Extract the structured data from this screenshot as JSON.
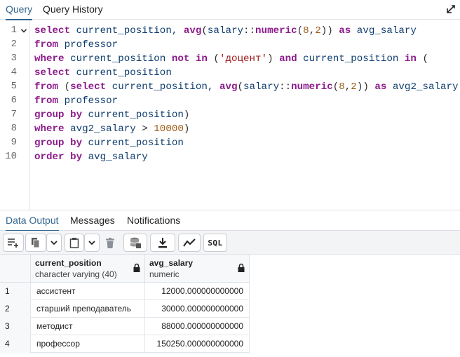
{
  "top_tabs": {
    "query": "Query",
    "history": "Query History"
  },
  "editor": {
    "line_numbers": [
      "1",
      "2",
      "3",
      "4",
      "5",
      "6",
      "7",
      "8",
      "9",
      "10"
    ]
  },
  "bottom_tabs": {
    "data_output": "Data Output",
    "messages": "Messages",
    "notifications": "Notifications"
  },
  "toolbar": {
    "sql_label": "SQL"
  },
  "grid": {
    "columns": [
      {
        "name": "current_position",
        "type": "character varying (40)"
      },
      {
        "name": "avg_salary",
        "type": "numeric"
      }
    ],
    "rows": [
      {
        "idx": "1",
        "position": "ассистент",
        "salary": "12000.000000000000"
      },
      {
        "idx": "2",
        "position": "старший преподаватель",
        "salary": "30000.000000000000"
      },
      {
        "idx": "3",
        "position": "методист",
        "salary": "88000.000000000000"
      },
      {
        "idx": "4",
        "position": "профессор",
        "salary": "150250.000000000000"
      }
    ]
  },
  "colors": {
    "accent": "#326690",
    "keyword": "#8c1b8c",
    "identifier": "#0f3d6e",
    "string": "#9e1a1a",
    "number": "#9c5a16"
  }
}
